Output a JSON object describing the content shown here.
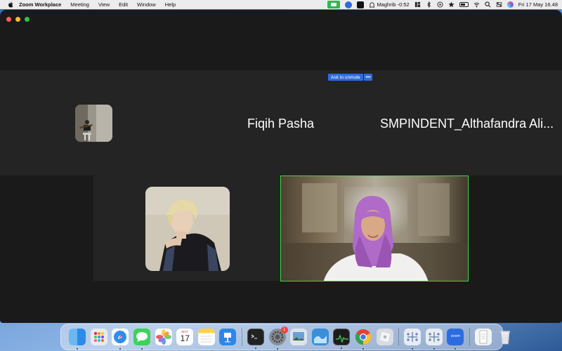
{
  "menubar": {
    "app_name": "Zoom Workplace",
    "menus": [
      "Meeting",
      "View",
      "Edit",
      "Window",
      "Help"
    ],
    "prayer_status": "Maghrib -0:52",
    "datetime": "Fri 17 May  16.48"
  },
  "window": {
    "unmute_label": "Ask to unmute",
    "more_label": "•••",
    "participants": [
      {
        "name": ""
      },
      {
        "name": "Fiqih Pasha"
      },
      {
        "name": "SMPINDENT_Althafandra Ali..."
      },
      {
        "name": ""
      },
      {
        "name": ""
      }
    ]
  },
  "dock": {
    "calendar_month": "MAY",
    "calendar_day": "17",
    "settings_badge": "1",
    "zoom_label": "zoom"
  },
  "colors": {
    "accent": "#2d6cdf",
    "active_speaker": "#3ed44b",
    "tile_bg": "#242424",
    "window_bg": "#1a1a1a"
  }
}
